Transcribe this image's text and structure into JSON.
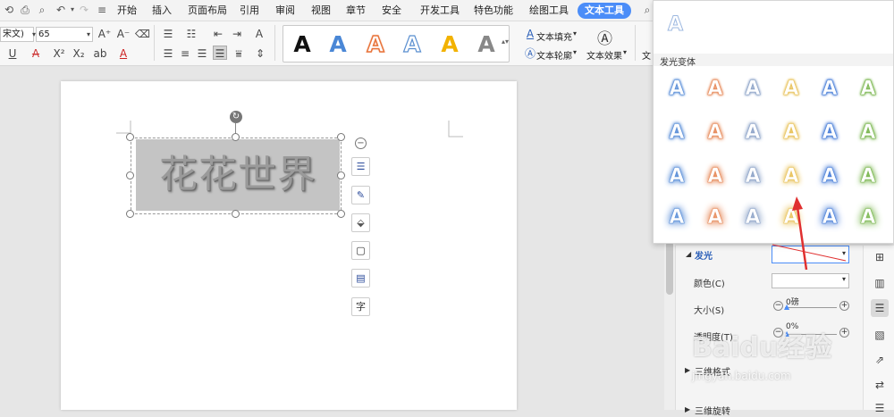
{
  "menus": [
    "开始",
    "插入",
    "页面布局",
    "引用",
    "审阅",
    "视图",
    "章节",
    "安全",
    "开发工具",
    "特色功能",
    "绘图工具",
    "文本工具"
  ],
  "font": {
    "name": "宋文)",
    "size": "65"
  },
  "ribbon": {
    "text_fill": "文本填充",
    "text_outline": "文本轮廓",
    "text_effect": "文本效果",
    "text_partial": "文"
  },
  "wordart": {
    "letter": "A",
    "colors": [
      "#111111",
      "#4a87d6",
      "#e8743b",
      "#5a8fd0",
      "#f2b200",
      "#888888"
    ]
  },
  "document": {
    "art_text": "花花世界"
  },
  "glow_panel": {
    "preview_letter": "A",
    "section_title": "发光变体",
    "rows": [
      [
        "#5b8fd8",
        "#e68a5a",
        "#8ea4c8",
        "#e8c25a",
        "#4a7fd8",
        "#7ab64f"
      ],
      [
        "#5b8fd8",
        "#e68a5a",
        "#8ea4c8",
        "#e8c25a",
        "#4a7fd8",
        "#7ab64f"
      ],
      [
        "#5b8fd8",
        "#e68a5a",
        "#8ea4c8",
        "#e8c25a",
        "#4a7fd8",
        "#7ab64f"
      ],
      [
        "#5b8fd8",
        "#e68a5a",
        "#8ea4c8",
        "#e8c25a",
        "#4a7fd8",
        "#7ab64f"
      ]
    ]
  },
  "format_panel": {
    "glow": "发光",
    "color": "颜色(C)",
    "size": "大小(S)",
    "size_value": "0磅",
    "transparency": "透明度(T)",
    "transparency_value": "0%",
    "three_d_format": "三维格式",
    "three_d_rotation": "三维旋转"
  },
  "watermark": {
    "brand": "Baidu经验",
    "url": "jingyan.baidu.com"
  },
  "colors": {
    "accent": "#4b8df8",
    "arrow": "#e03030"
  }
}
